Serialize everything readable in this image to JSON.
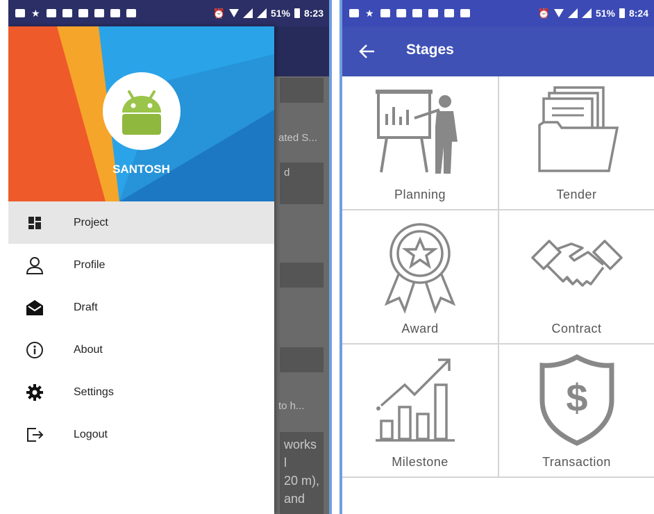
{
  "left_phone": {
    "status_bar": {
      "battery_percent": "51%",
      "time": "8:23"
    },
    "drawer": {
      "user_name": "SANTOSH",
      "menu_items": [
        {
          "label": "Project",
          "icon": "dashboard-icon",
          "active": true
        },
        {
          "label": "Profile",
          "icon": "person-icon"
        },
        {
          "label": "Draft",
          "icon": "mail-open-icon"
        },
        {
          "label": "About",
          "icon": "info-icon"
        },
        {
          "label": "Settings",
          "icon": "gear-icon"
        },
        {
          "label": "Logout",
          "icon": "logout-icon"
        }
      ]
    },
    "background_text": [
      "ated S...",
      "d",
      "to h...",
      "works",
      "l",
      "20 m),",
      "and"
    ]
  },
  "right_phone": {
    "status_bar": {
      "battery_percent": "51%",
      "time": "8:24"
    },
    "app_bar": {
      "title": "Stages"
    },
    "stages": [
      {
        "label": "Planning",
        "icon": "presentation-board-icon"
      },
      {
        "label": "Tender",
        "icon": "document-folder-icon"
      },
      {
        "label": "Award",
        "icon": "award-ribbon-icon"
      },
      {
        "label": "Contract",
        "icon": "handshake-icon"
      },
      {
        "label": "Milestone",
        "icon": "growth-chart-icon"
      },
      {
        "label": "Transaction",
        "icon": "dollar-shield-icon"
      }
    ]
  },
  "colors": {
    "primary": "#3f51b5",
    "status_bar_right": "#3b4ab5",
    "status_bar_left": "#2b2f66",
    "header_orange": "#ef5a2a",
    "header_yellow": "#f5a52a",
    "header_blue": "#2e86cc"
  }
}
